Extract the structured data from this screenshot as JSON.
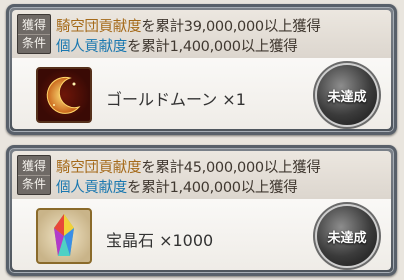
{
  "tag": {
    "line1": "獲得",
    "line2": "条件"
  },
  "rewards": [
    {
      "cond1_key": "騎空団貢献度",
      "cond1_rest": "を累計39,000,000以上獲得",
      "cond2_key": "個人貢献度",
      "cond2_rest": "を累計1,400,000以上獲得",
      "item": "ゴールドムーン ×1",
      "item_icon": "gold-moon-icon",
      "status": "未達成"
    },
    {
      "cond1_key": "騎空団貢献度",
      "cond1_rest": "を累計45,000,000以上獲得",
      "cond2_key": "個人貢献度",
      "cond2_rest": "を累計1,400,000以上獲得",
      "item": "宝晶石 ×1000",
      "item_icon": "crystal-icon",
      "status": "未達成"
    }
  ],
  "colors": {
    "highlight_orange": "#a56a1a",
    "highlight_blue": "#1a78b0"
  }
}
